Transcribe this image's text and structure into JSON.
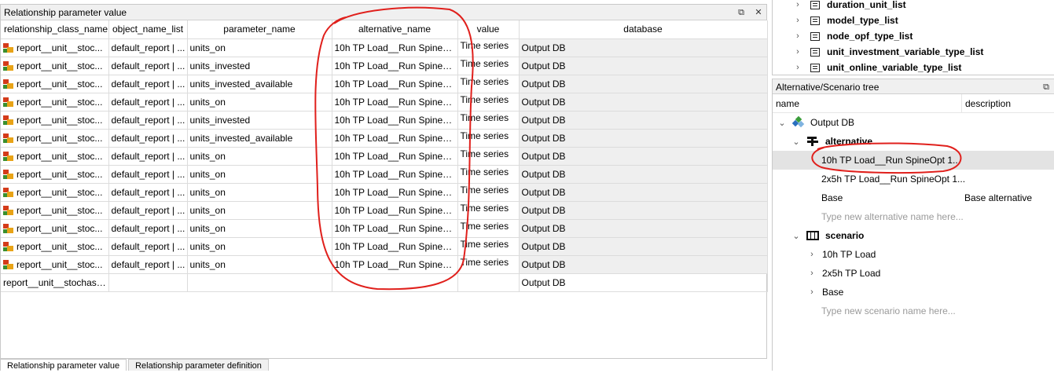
{
  "left_panel": {
    "title": "Relationship parameter value",
    "float_icon": "⧉",
    "close_icon": "✕",
    "columns": [
      "relationship_class_name",
      "object_name_list",
      "parameter_name",
      "alternative_name",
      "value",
      "database"
    ],
    "rows": [
      {
        "cls": "report__unit__stoc...",
        "obj": "default_report | ...",
        "param": "units_on",
        "alt": "10h TP Load__Run SpineOp...",
        "value": "Time series",
        "db": "Output DB"
      },
      {
        "cls": "report__unit__stoc...",
        "obj": "default_report | ...",
        "param": "units_invested",
        "alt": "10h TP Load__Run SpineOp...",
        "value": "Time series",
        "db": "Output DB"
      },
      {
        "cls": "report__unit__stoc...",
        "obj": "default_report | ...",
        "param": "units_invested_available",
        "alt": "10h TP Load__Run SpineOp...",
        "value": "Time series",
        "db": "Output DB"
      },
      {
        "cls": "report__unit__stoc...",
        "obj": "default_report | ...",
        "param": "units_on",
        "alt": "10h TP Load__Run SpineOp...",
        "value": "Time series",
        "db": "Output DB"
      },
      {
        "cls": "report__unit__stoc...",
        "obj": "default_report | ...",
        "param": "units_invested",
        "alt": "10h TP Load__Run SpineOp...",
        "value": "Time series",
        "db": "Output DB"
      },
      {
        "cls": "report__unit__stoc...",
        "obj": "default_report | ...",
        "param": "units_invested_available",
        "alt": "10h TP Load__Run SpineOp...",
        "value": "Time series",
        "db": "Output DB"
      },
      {
        "cls": "report__unit__stoc...",
        "obj": "default_report | ...",
        "param": "units_on",
        "alt": "10h TP Load__Run SpineOp...",
        "value": "Time series",
        "db": "Output DB"
      },
      {
        "cls": "report__unit__stoc...",
        "obj": "default_report | ...",
        "param": "units_on",
        "alt": "10h TP Load__Run SpineOp...",
        "value": "Time series",
        "db": "Output DB"
      },
      {
        "cls": "report__unit__stoc...",
        "obj": "default_report | ...",
        "param": "units_on",
        "alt": "10h TP Load__Run SpineOp...",
        "value": "Time series",
        "db": "Output DB"
      },
      {
        "cls": "report__unit__stoc...",
        "obj": "default_report | ...",
        "param": "units_on",
        "alt": "10h TP Load__Run SpineOp...",
        "value": "Time series",
        "db": "Output DB"
      },
      {
        "cls": "report__unit__stoc...",
        "obj": "default_report | ...",
        "param": "units_on",
        "alt": "10h TP Load__Run SpineOp...",
        "value": "Time series",
        "db": "Output DB"
      },
      {
        "cls": "report__unit__stoc...",
        "obj": "default_report | ...",
        "param": "units_on",
        "alt": "10h TP Load__Run SpineOp...",
        "value": "Time series",
        "db": "Output DB"
      },
      {
        "cls": "report__unit__stoc...",
        "obj": "default_report | ...",
        "param": "units_on",
        "alt": "10h TP Load__Run SpineOp...",
        "value": "Time series",
        "db": "Output DB"
      }
    ],
    "empty_row": {
      "cls": "report__unit__stochasti...",
      "db": "Output DB"
    },
    "tabs": [
      "Relationship parameter value",
      "Relationship parameter definition"
    ]
  },
  "right_top": {
    "items": [
      "duration_unit_list",
      "model_type_list",
      "node_opf_type_list",
      "unit_investment_variable_type_list",
      "unit_online_variable_type_list"
    ]
  },
  "alt_tree": {
    "title": "Alternative/Scenario tree",
    "float_icon": "⧉",
    "header_name": "name",
    "header_desc": "description",
    "db_name": "Output DB",
    "alternative_label": "alternative",
    "alternatives": [
      {
        "name": "10h TP Load__Run SpineOpt 1...",
        "desc": ""
      },
      {
        "name": "2x5h TP Load__Run SpineOpt 1...",
        "desc": ""
      },
      {
        "name": "Base",
        "desc": "Base alternative"
      }
    ],
    "alt_placeholder": "Type new alternative name here...",
    "scenario_label": "scenario",
    "scenarios": [
      "10h TP Load",
      "2x5h TP Load",
      "Base"
    ],
    "scen_placeholder": "Type new scenario name here..."
  },
  "colors": {
    "annotation": "#e0201c",
    "selected_row": "#e3e3e3",
    "db_cell": "#efefef"
  }
}
